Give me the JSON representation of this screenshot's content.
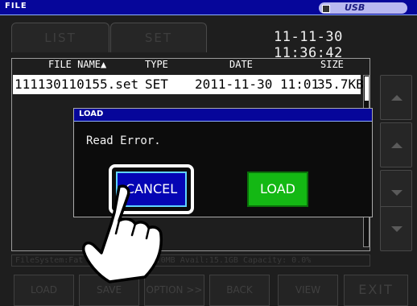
{
  "app": {
    "title": "FILE",
    "usb_label": "USB"
  },
  "tabs": [
    {
      "label": "LIST"
    },
    {
      "label": "SET"
    }
  ],
  "datetime": "11-11-30 11:36:42",
  "file_list": {
    "columns": [
      "FILE NAME▲",
      "TYPE",
      "DATE",
      "SIZE"
    ],
    "rows": [
      {
        "name": "111130110155.set",
        "type": "SET",
        "date": "2011-11-30 11:01",
        "size": "35.7KB",
        "selected": true
      }
    ]
  },
  "side_buttons": [
    {
      "icon": "scroll-top-icon"
    },
    {
      "icon": "up-arrow-icon"
    },
    {
      "icon": "down-arrow-icon"
    },
    {
      "icon": "scroll-bottom-icon"
    }
  ],
  "status": "FileSystem:Fat  15.1GB Used: 7.0MB Avail:15.1GB Capacity: 0.0%",
  "function_keys": [
    "LOAD",
    "SAVE",
    "OPTION >>",
    "BACK",
    "VIEW",
    "EXIT"
  ],
  "dialog": {
    "title": "LOAD",
    "message": "Read Error.",
    "cancel_label": "CANCEL",
    "load_label": "LOAD"
  },
  "colors": {
    "title_bar": "#06069a",
    "cancel_button": "#0505b4",
    "load_button": "#14b814",
    "screen_bg": "#1e1e1e"
  }
}
